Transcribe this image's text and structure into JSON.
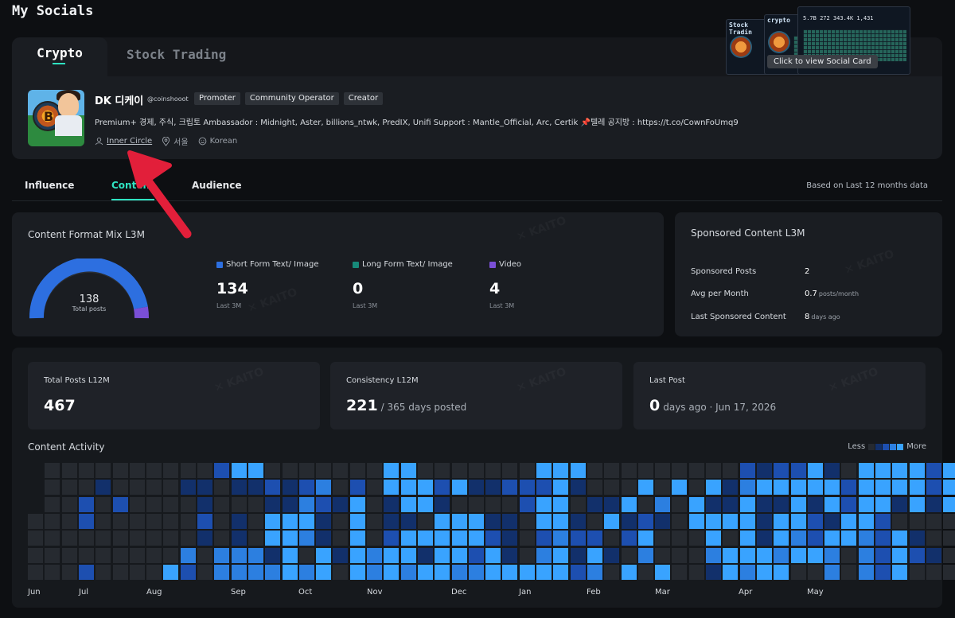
{
  "page_title": "My Socials",
  "tabs": {
    "active": "Crypto",
    "inactive": "Stock Trading"
  },
  "social_card": {
    "tooltip": "Click to view Social Card",
    "thumb1_header": "Stock Tradin",
    "thumb2_header": "crypto",
    "thumb_numbers": "5.7B   272   343.4K   1,431"
  },
  "profile": {
    "name": "DK 디케이",
    "handle": "@coinshooot",
    "badges": [
      "Promoter",
      "Community Operator",
      "Creator"
    ],
    "bio": "Premium+ 경제, 주식, 크립토 Ambassador : Midnight, Aster, billions_ntwk, PredIX, Unifi Support : Mantle_Official, Arc, Certik 📌텔레 공지방 : https://t.co/CownFoUmq9",
    "inner_circle": "Inner Circle",
    "location": "서울",
    "language": "Korean"
  },
  "subtabs": {
    "influence": "Influence",
    "content": "Content",
    "audience": "Audience"
  },
  "based_on": "Based on Last 12 months data",
  "content_format": {
    "title": "Content Format Mix L3M",
    "total": "138",
    "total_label": "Total posts",
    "items": [
      {
        "label": "Short Form Text/ Image",
        "value": "134",
        "sub": "Last 3M",
        "color": "#2d6fe0"
      },
      {
        "label": "Long Form Text/ Image",
        "value": "0",
        "sub": "Last 3M",
        "color": "#178a7a"
      },
      {
        "label": "Video",
        "value": "4",
        "sub": "Last 3M",
        "color": "#7a4fd6"
      }
    ]
  },
  "sponsored": {
    "title": "Sponsored Content L3M",
    "rows": [
      {
        "label": "Sponsored Posts",
        "value": "2",
        "unit": ""
      },
      {
        "label": "Avg per Month",
        "value": "0.7",
        "unit": "posts/month"
      },
      {
        "label": "Last Sponsored Content",
        "value": "8",
        "unit": "days ago"
      }
    ]
  },
  "stats": {
    "total_posts": {
      "title": "Total Posts L12M",
      "value": "467"
    },
    "consistency": {
      "title": "Consistency L12M",
      "value": "221",
      "suffix": "/ 365 days posted"
    },
    "last_post": {
      "title": "Last Post",
      "value": "0",
      "suffix": "days ago · Jun 17, 2026"
    }
  },
  "activity": {
    "title": "Content Activity",
    "less": "Less",
    "more": "More",
    "months": [
      "Jun",
      "Jul",
      "Aug",
      "Sep",
      "Oct",
      "Nov",
      "Dec",
      "Jan",
      "Feb",
      "Mar",
      "Apr",
      "May"
    ],
    "colors": [
      "#262a30",
      "#12306b",
      "#1d4fb0",
      "#2c7fe0",
      "#39a3ff"
    ],
    "weeks": [
      [
        -1,
        -1,
        -1,
        0,
        0,
        0,
        0
      ],
      [
        0,
        0,
        0,
        0,
        0,
        0,
        0
      ],
      [
        0,
        0,
        0,
        0,
        0,
        0,
        0
      ],
      [
        0,
        0,
        2,
        2,
        0,
        0,
        2
      ],
      [
        0,
        1,
        0,
        0,
        0,
        0,
        0
      ],
      [
        0,
        0,
        2,
        0,
        0,
        0,
        0
      ],
      [
        0,
        0,
        0,
        0,
        0,
        0,
        0
      ],
      [
        0,
        0,
        0,
        0,
        0,
        0,
        0
      ],
      [
        0,
        0,
        0,
        0,
        0,
        0,
        4
      ],
      [
        0,
        1,
        0,
        0,
        0,
        3,
        2
      ],
      [
        0,
        1,
        1,
        2,
        1,
        0,
        0
      ],
      [
        2,
        0,
        0,
        0,
        0,
        3,
        3
      ],
      [
        4,
        1,
        0,
        1,
        1,
        3,
        3
      ],
      [
        4,
        1,
        0,
        0,
        0,
        3,
        3
      ],
      [
        0,
        2,
        1,
        4,
        4,
        1,
        3
      ],
      [
        0,
        1,
        1,
        4,
        4,
        4,
        4
      ],
      [
        0,
        2,
        3,
        4,
        3,
        0,
        3
      ],
      [
        0,
        3,
        2,
        1,
        1,
        4,
        4
      ],
      [
        0,
        0,
        1,
        0,
        0,
        1,
        0
      ],
      [
        0,
        2,
        4,
        4,
        4,
        4,
        4
      ],
      [
        0,
        0,
        0,
        0,
        0,
        3,
        3
      ],
      [
        4,
        4,
        1,
        1,
        2,
        4,
        4
      ],
      [
        4,
        4,
        4,
        1,
        4,
        4,
        3
      ],
      [
        0,
        4,
        4,
        0,
        4,
        1,
        4
      ],
      [
        0,
        2,
        1,
        4,
        4,
        4,
        4
      ],
      [
        0,
        4,
        0,
        4,
        4,
        4,
        3
      ],
      [
        0,
        1,
        0,
        4,
        4,
        2,
        3
      ],
      [
        0,
        1,
        0,
        1,
        2,
        4,
        4
      ],
      [
        0,
        2,
        0,
        1,
        1,
        1,
        4
      ],
      [
        0,
        2,
        2,
        0,
        0,
        0,
        4
      ],
      [
        4,
        2,
        4,
        4,
        2,
        3,
        4
      ],
      [
        4,
        4,
        4,
        4,
        3,
        4,
        4
      ],
      [
        4,
        1,
        0,
        1,
        2,
        1,
        2
      ],
      [
        0,
        0,
        1,
        0,
        2,
        4,
        3
      ],
      [
        0,
        0,
        1,
        4,
        0,
        1,
        0
      ],
      [
        0,
        0,
        4,
        1,
        2,
        0,
        4
      ],
      [
        0,
        4,
        0,
        2,
        4,
        3,
        0
      ],
      [
        0,
        0,
        3,
        1,
        0,
        0,
        4
      ],
      [
        0,
        4,
        0,
        0,
        0,
        0,
        0
      ],
      [
        0,
        0,
        4,
        4,
        0,
        0,
        0
      ],
      [
        0,
        4,
        1,
        4,
        4,
        3,
        1
      ],
      [
        0,
        1,
        1,
        4,
        0,
        4,
        4
      ],
      [
        2,
        3,
        4,
        4,
        4,
        4,
        3
      ],
      [
        1,
        4,
        1,
        1,
        1,
        4,
        4
      ],
      [
        2,
        4,
        1,
        4,
        4,
        3,
        4
      ],
      [
        2,
        4,
        4,
        4,
        3,
        4,
        0
      ],
      [
        4,
        4,
        1,
        2,
        2,
        4,
        0
      ],
      [
        1,
        4,
        4,
        1,
        4,
        3,
        3
      ],
      [
        0,
        2,
        2,
        4,
        4,
        0,
        0
      ],
      [
        4,
        4,
        4,
        4,
        3,
        3,
        3
      ],
      [
        4,
        4,
        4,
        2,
        2,
        2,
        2
      ],
      [
        4,
        4,
        1,
        0,
        4,
        4,
        4
      ],
      [
        4,
        4,
        4,
        0,
        1,
        2,
        0
      ],
      [
        2,
        2,
        1,
        0,
        0,
        1,
        0
      ],
      [
        4,
        4,
        4,
        0,
        0,
        0,
        0
      ]
    ]
  }
}
